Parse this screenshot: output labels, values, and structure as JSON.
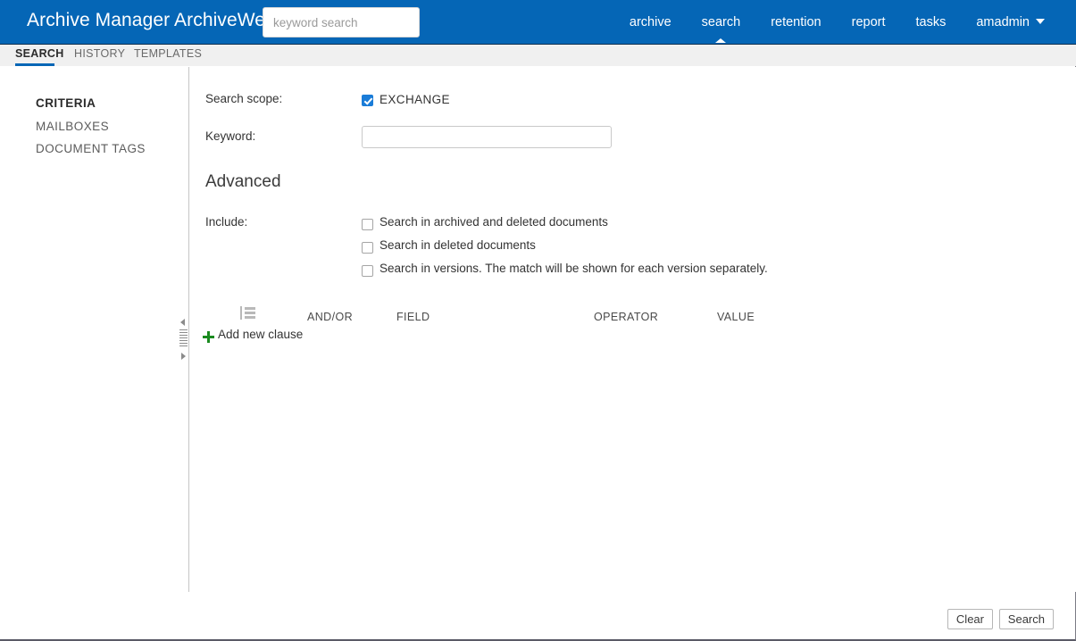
{
  "header": {
    "brand": "Archive Manager ArchiveWeb",
    "search": {
      "placeholder": "keyword search",
      "value": ""
    },
    "nav": [
      {
        "label": "archive",
        "active": false
      },
      {
        "label": "search",
        "active": true
      },
      {
        "label": "retention",
        "active": false
      },
      {
        "label": "report",
        "active": false
      },
      {
        "label": "tasks",
        "active": false
      },
      {
        "label": "amadmin",
        "active": false,
        "caret": "chevron-down-icon"
      }
    ]
  },
  "tabs": [
    {
      "label": "SEARCH",
      "active": true
    },
    {
      "label": "HISTORY",
      "active": false
    },
    {
      "label": "TEMPLATES",
      "active": false
    }
  ],
  "sidebar": {
    "items": [
      {
        "label": "CRITERIA",
        "active": true
      },
      {
        "label": "MAILBOXES",
        "active": false
      },
      {
        "label": "DOCUMENT TAGS",
        "active": false
      }
    ]
  },
  "main": {
    "scope_label": "Search scope:",
    "scope_option": {
      "label": "EXCHANGE",
      "checked": true
    },
    "keyword_label": "Keyword:",
    "keyword_value": "",
    "keyword_placeholder": "",
    "advanced_title": "Advanced",
    "include_label": "Include:",
    "include_options": [
      {
        "label": "Search in archived and deleted documents",
        "checked": false
      },
      {
        "label": "Search in deleted documents",
        "checked": false
      },
      {
        "label": "Search in versions. The match will be shown for each version separately.",
        "checked": false
      }
    ],
    "clause_table": {
      "columns": [
        "AND/OR",
        "FIELD",
        "OPERATOR",
        "VALUE"
      ],
      "rows": [],
      "add_label": "Add new clause"
    }
  },
  "footer": {
    "clear_label": "Clear",
    "search_label": "Search"
  },
  "colors": {
    "brand_blue": "#0566b6",
    "checkbox_blue": "#1a7cd8",
    "plus_green": "#1a8a1f",
    "tabstrip_gray": "#f0f0f0"
  }
}
